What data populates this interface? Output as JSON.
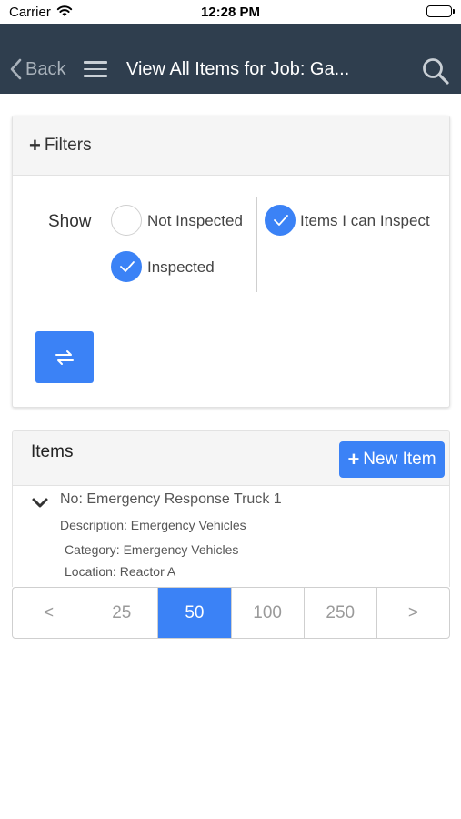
{
  "status_bar": {
    "carrier": "Carrier",
    "time": "12:28 PM"
  },
  "nav": {
    "back_label": "Back",
    "title": "View All Items for Job: Ga..."
  },
  "filters": {
    "header_label": "Filters",
    "show_label": "Show",
    "options": [
      {
        "label": "Not Inspected",
        "checked": false
      },
      {
        "label": "Inspected",
        "checked": true
      },
      {
        "label": "Items I can Inspect",
        "checked": true
      }
    ]
  },
  "items": {
    "title": "Items",
    "new_item_label": "New Item",
    "rows": [
      {
        "no": "No: Emergency Response Truck 1",
        "description": "Description: Emergency Vehicles",
        "category": "Category: Emergency Vehicles",
        "location": "Location: Reactor A"
      }
    ]
  },
  "pagination": {
    "pages": [
      "<",
      "25",
      "50",
      "100",
      "250",
      ">"
    ],
    "active": "50"
  },
  "colors": {
    "nav_background": "#2f3e4e",
    "accent": "#3b82f6"
  },
  "icons": {
    "back": "chevron-left-icon",
    "menu": "hamburger-menu-icon",
    "search": "search-icon",
    "swap": "swap-arrows-icon",
    "expand": "chevron-down-icon"
  }
}
